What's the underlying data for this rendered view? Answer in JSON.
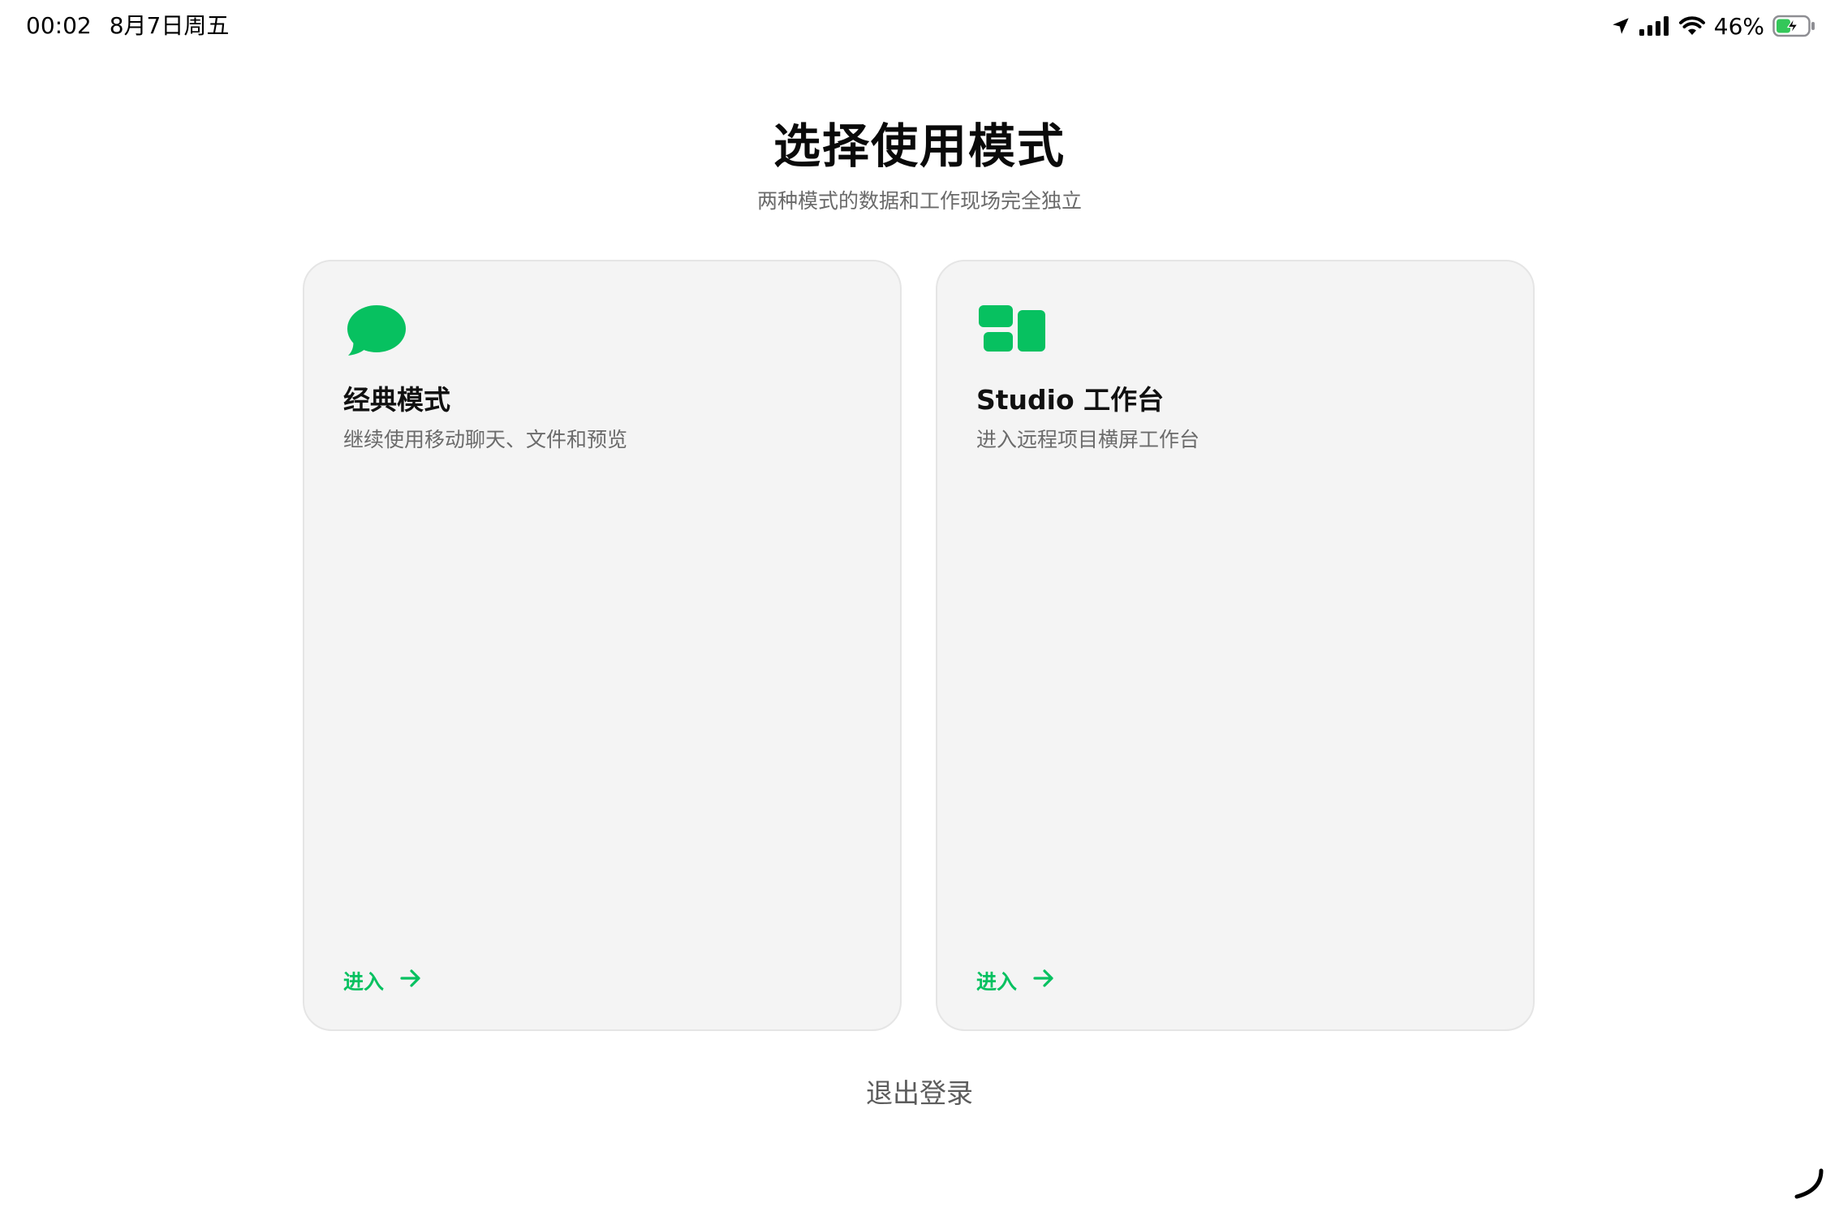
{
  "status_bar": {
    "time": "00:02",
    "date": "8月7日周五",
    "battery_percent": "46%",
    "battery_level": 0.46,
    "icons": [
      "location-icon",
      "cellular-signal-icon",
      "wifi-icon",
      "battery-charging-icon"
    ]
  },
  "header": {
    "title": "选择使用模式",
    "subtitle": "两种模式的数据和工作现场完全独立"
  },
  "cards": [
    {
      "icon": "chat-bubble-icon",
      "title": "经典模式",
      "description": "继续使用移动聊天、文件和预览",
      "action_label": "进入"
    },
    {
      "icon": "dashboard-grid-icon",
      "title": "Studio 工作台",
      "description": "进入远程项目横屏工作台",
      "action_label": "进入"
    }
  ],
  "footer": {
    "logout_label": "退出登录"
  },
  "colors": {
    "accent": "#07c160",
    "card_background": "#f4f4f4",
    "card_border": "#e5e5e5",
    "title_text": "#0a0a0a",
    "secondary_text": "#6b6b6b"
  }
}
